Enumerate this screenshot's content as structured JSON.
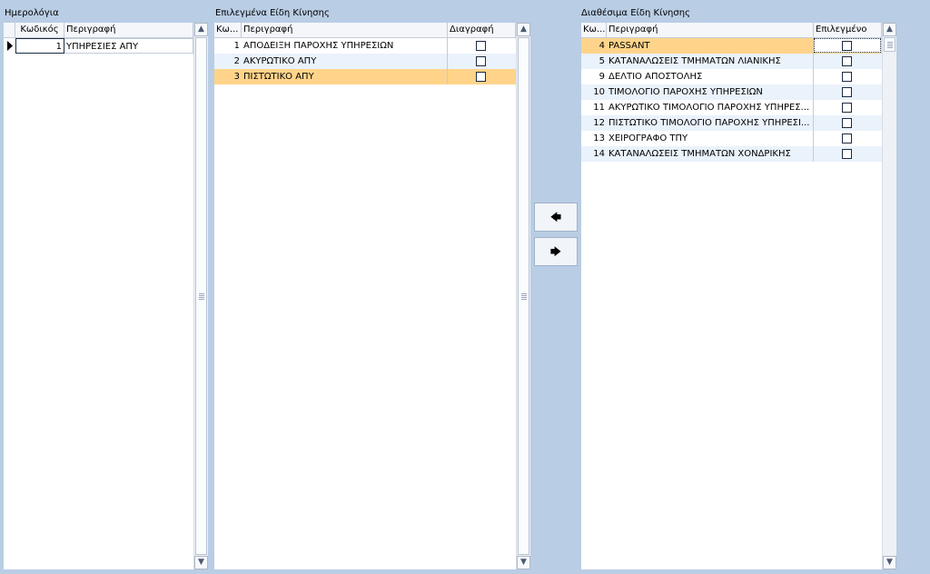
{
  "journals": {
    "title": "Ημερολόγια",
    "columns": [
      "Κωδικός",
      "Περιγραφή"
    ],
    "rows": [
      {
        "code": "1",
        "desc": "ΥΠΗΡΕΣΙΕΣ ΑΠΥ"
      }
    ]
  },
  "selected": {
    "title": "Επιλεγμένα Είδη Κίνησης",
    "columns": [
      "Κω...",
      "Περιγραφή",
      "Διαγραφή"
    ],
    "rows": [
      {
        "code": "1",
        "desc": "ΑΠΟΔΕΙΞΗ ΠΑΡΟΧΗΣ ΥΠΗΡΕΣΙΩΝ"
      },
      {
        "code": "2",
        "desc": "ΑΚΥΡΩΤΙΚΟ ΑΠΥ"
      },
      {
        "code": "3",
        "desc": "ΠΙΣΤΩΤΙΚΟ ΑΠΥ"
      }
    ]
  },
  "available": {
    "title": "Διαθέσιμα Είδη Κίνησης",
    "columns": [
      "Κω...",
      "Περιγραφή",
      "Επιλεγμένο"
    ],
    "rows": [
      {
        "code": "4",
        "desc": "PASSANT"
      },
      {
        "code": "5",
        "desc": "ΚΑΤΑΝΑΛΩΣΕΙΣ ΤΜΗΜΑΤΩΝ ΛΙΑΝΙΚΗΣ"
      },
      {
        "code": "9",
        "desc": "ΔΕΛΤΙΟ ΑΠΟΣΤΟΛΗΣ"
      },
      {
        "code": "10",
        "desc": "ΤΙΜΟΛΟΓΙΟ ΠΑΡΟΧΗΣ ΥΠΗΡΕΣΙΩΝ"
      },
      {
        "code": "11",
        "desc": "ΑΚΥΡΩΤΙΚΟ ΤΙΜΟΛΟΓΙΟ ΠΑΡΟΧΗΣ ΥΠΗΡΕΣ..."
      },
      {
        "code": "12",
        "desc": "ΠΙΣΤΩΤΙΚΟ ΤΙΜΟΛΟΓΙΟ ΠΑΡΟΧΗΣ ΥΠΗΡΕΣΙ..."
      },
      {
        "code": "13",
        "desc": "ΧΕΙΡΟΓΡΑΦΟ ΤΠΥ"
      },
      {
        "code": "14",
        "desc": "ΚΑΤΑΝΑΛΩΣΕΙΣ ΤΜΗΜΑΤΩΝ ΧΟΝΔΡΙΚΗΣ"
      }
    ]
  },
  "buttons": {
    "move_left_icon": "arrow-left-icon",
    "move_right_icon": "arrow-right-icon",
    "move_left_glyph": "🡄",
    "move_right_glyph": "🡆"
  },
  "colors": {
    "background": "#b9cde4",
    "selected_row": "#ffd48a",
    "alt_row": "#eaf2fb"
  }
}
